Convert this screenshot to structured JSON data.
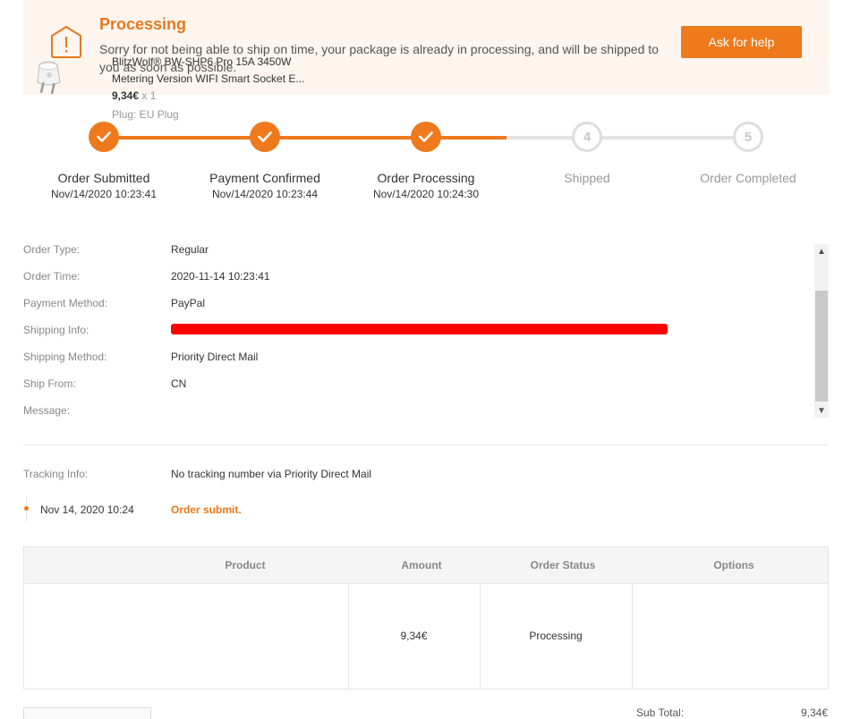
{
  "alert": {
    "title": "Processing",
    "message": "Sorry for not being able to ship on time, your package is already in processing, and will be shipped to you as soon as possible.",
    "help_button": "Ask for help",
    "icon": "warning-icon"
  },
  "steps": [
    {
      "number": "1",
      "label": "Order Submitted",
      "time": "Nov/14/2020 10:23:41",
      "status": "done"
    },
    {
      "number": "2",
      "label": "Payment Confirmed",
      "time": "Nov/14/2020 10:23:44",
      "status": "done"
    },
    {
      "number": "3",
      "label": "Order Processing",
      "time": "Nov/14/2020 10:24:30",
      "status": "done"
    },
    {
      "number": "4",
      "label": "Shipped",
      "time": "",
      "status": "todo"
    },
    {
      "number": "5",
      "label": "Order Completed",
      "time": "",
      "status": "todo"
    }
  ],
  "order_info": {
    "order_type_label": "Order Type:",
    "order_type": "Regular",
    "order_time_label": "Order Time:",
    "order_time": "2020-11-14 10:23:41",
    "payment_method_label": "Payment Method:",
    "payment_method": "PayPal",
    "shipping_info_label": "Shipping Info:",
    "shipping_method_label": "Shipping Method:",
    "shipping_method": "Priority Direct Mail",
    "ship_from_label": "Ship From:",
    "ship_from": "CN",
    "message_label": "Message:",
    "message": ""
  },
  "tracking": {
    "label": "Tracking Info:",
    "value": "No tracking number via Priority Direct Mail",
    "events": [
      {
        "time": "Nov 14, 2020 10:24",
        "status": "Order submit."
      }
    ]
  },
  "product_table": {
    "headers": [
      "Product",
      "Amount",
      "Order Status",
      "Options"
    ],
    "rows": [
      {
        "name": "BlitzWolf® BW-SHP6 Pro 15A 3450W Metering Version WIFI Smart Socket E...",
        "price": "9,34€",
        "qty": "x 1",
        "option": "Plug: EU Plug",
        "amount": "9,34€",
        "status": "Processing"
      }
    ]
  },
  "summary": {
    "subtotal_label": "Sub Total:",
    "subtotal": "9,34€"
  },
  "colors": {
    "accent": "#ee7a1c",
    "banner_bg": "#fdf5ee",
    "step_todo": "#dedede"
  }
}
